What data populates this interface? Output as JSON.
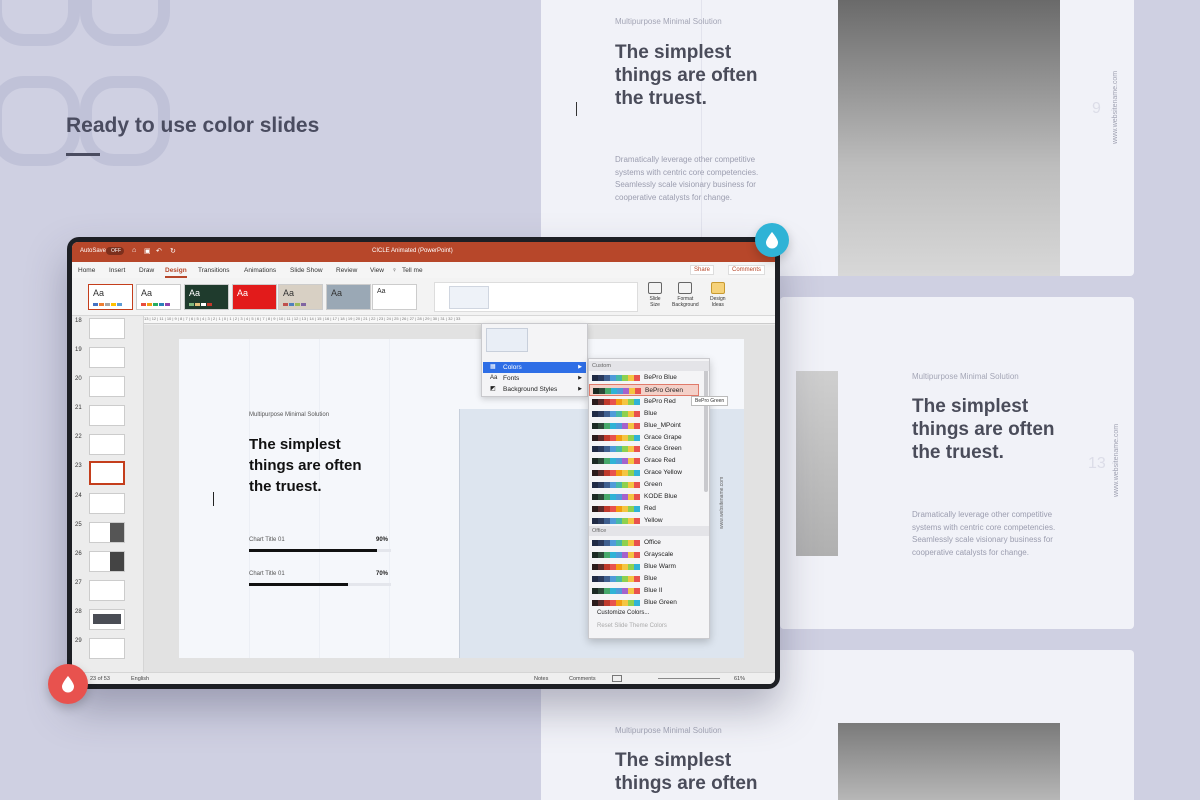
{
  "headline": "Ready to use color slides",
  "cards": {
    "top": {
      "subtitle": "Multipurpose Minimal Solution",
      "title_lines": [
        "The simplest",
        "things are often",
        "the truest."
      ],
      "body_lines": [
        "Dramatically leverage other competitive",
        "systems with centric core competencies.",
        "Seamlessly scale visionary business for",
        "cooperative catalysts for change."
      ],
      "number": "9",
      "website": "www.websitename.com"
    },
    "middle": {
      "subtitle": "Multipurpose Minimal Solution",
      "title_lines": [
        "The simplest",
        "things are often",
        "the truest."
      ],
      "body_lines": [
        "Dramatically leverage other competitive",
        "systems with centric core competencies.",
        "Seamlessly scale visionary business for",
        "cooperative catalysts for change."
      ],
      "number": "13",
      "website": "www.websitename.com"
    },
    "bottom": {
      "subtitle": "Multipurpose Minimal Solution",
      "title_lines": [
        "The simplest",
        "things are often"
      ]
    }
  },
  "app": {
    "autosave": "AutoSave",
    "autosave_state": "OFF",
    "doc_title": "CICLE Animated (PowerPoint)",
    "tabs": [
      "Home",
      "Insert",
      "Draw",
      "Design",
      "Transitions",
      "Animations",
      "Slide Show",
      "Review",
      "View"
    ],
    "active_tab": "Design",
    "tell_me": "Tell me",
    "share": "Share",
    "comments": "Comments",
    "ribbon_buttons": [
      {
        "name": "slide-size",
        "line1": "Slide",
        "line2": "Size"
      },
      {
        "name": "format-background",
        "line1": "Format",
        "line2": "Background"
      },
      {
        "name": "design-ideas",
        "line1": "Design",
        "line2": "Ideas"
      }
    ],
    "ruler": "13 | 12 | 11 | 10 | 9 | 8 | 7 | 6 | 5 | 4 | 3 | 2 | 1 | 0 | 1 | 2 | 3 | 4 | 5 | 6 | 7 | 8 | 9 | 10 | 11 | 12 | 13 | 14 | 15 | 16 | 17 | 18 | 19 | 20 | 21 | 22 | 23 | 24 | 25 | 26 | 27 | 28 | 29 | 30 | 31 | 32 | 33",
    "slide_numbers": [
      "18",
      "19",
      "20",
      "21",
      "22",
      "23",
      "24",
      "25",
      "26",
      "27",
      "28",
      "29"
    ],
    "selected_slide": "23",
    "status": {
      "slide_of": "23 of 53",
      "language": "English",
      "notes": "Notes",
      "comments": "Comments",
      "zoom": "61%"
    }
  },
  "slide": {
    "subtitle": "Multipurpose Minimal Solution",
    "title_lines": [
      "The simplest",
      "things are often",
      "the truest."
    ],
    "bars": [
      {
        "label": "Chart Title 01",
        "value": "90%",
        "fraction": 0.9
      },
      {
        "label": "Chart Title 01",
        "value": "70%",
        "fraction": 0.7
      }
    ],
    "website": "www.websitename.com"
  },
  "menu": {
    "items": [
      "Colors",
      "Fonts",
      "Background Styles"
    ],
    "section_custom": "Custom",
    "section_office": "Office",
    "custom_colors": [
      "BePro Blue",
      "BePro Green",
      "BePro Red",
      "Blue",
      "Blue_MPoint",
      "Grace Grape",
      "Grace Green",
      "Grace Red",
      "Grace Yellow",
      "Green",
      "KODE Blue",
      "Red",
      "Yellow"
    ],
    "office_colors": [
      "Office",
      "Grayscale",
      "Blue Warm",
      "Blue",
      "Blue II",
      "Blue Green"
    ],
    "highlighted": "BePro Green",
    "tooltip": "BePro Green",
    "customize": "Customize Colors...",
    "reset": "Reset Slide Theme Colors"
  },
  "colors": {
    "ppt_red": "#b7472a",
    "accent_teal": "#2fb3d6",
    "accent_red": "#e8524e"
  }
}
